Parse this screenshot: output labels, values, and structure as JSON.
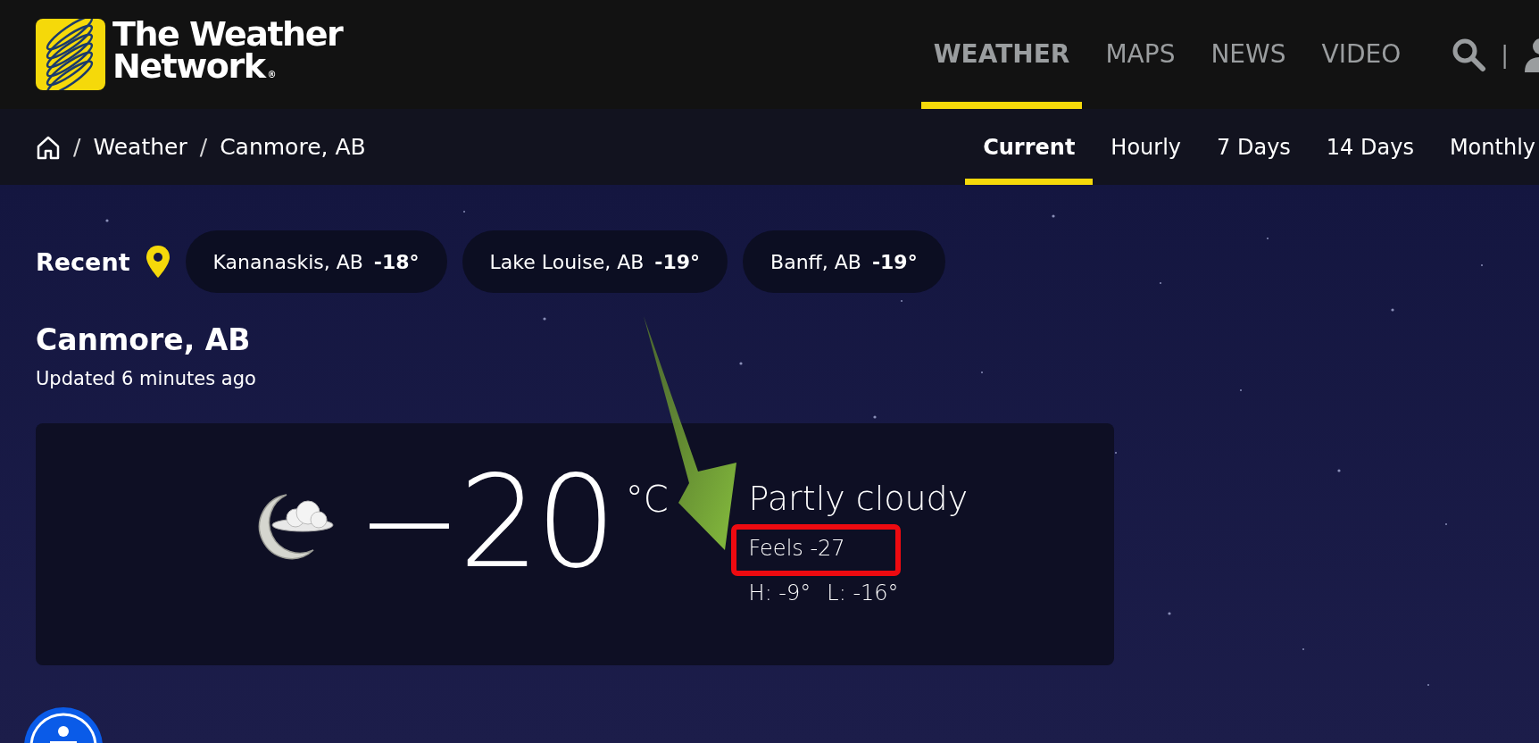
{
  "header": {
    "logo": {
      "line_1": "The Weather",
      "line_2": "Network",
      "mark": "®"
    },
    "nav": [
      {
        "label": "WEATHER",
        "selected": true
      },
      {
        "label": "MAPS",
        "selected": false
      },
      {
        "label": "NEWS",
        "selected": false
      },
      {
        "label": "VIDEO",
        "selected": false
      }
    ],
    "divider": "|"
  },
  "breadcrumbs": [
    {
      "separator": "/",
      "label": "Weather"
    },
    {
      "separator": "/",
      "label": "Canmore, AB"
    }
  ],
  "tabs": [
    {
      "label": "Current",
      "selected": true
    },
    {
      "label": "Hourly",
      "selected": false
    },
    {
      "label": "7 Days",
      "selected": false
    },
    {
      "label": "14 Days",
      "selected": false
    },
    {
      "label": "Monthly",
      "selected": false
    }
  ],
  "recent": {
    "label": "Recent",
    "locations": [
      {
        "name": "Kananaskis, AB",
        "temp": "-18°"
      },
      {
        "name": "Lake Louise, AB",
        "temp": "-19°"
      },
      {
        "name": "Banff, AB",
        "temp": "-19°"
      }
    ]
  },
  "location": {
    "name": "Canmore, AB",
    "updated": "Updated 6 minutes ago"
  },
  "current": {
    "temperature": "−20",
    "unit": "°C",
    "condition": "Partly cloudy",
    "feels": "Feels -27",
    "high": "H: -9°",
    "low": "L: -16°"
  }
}
